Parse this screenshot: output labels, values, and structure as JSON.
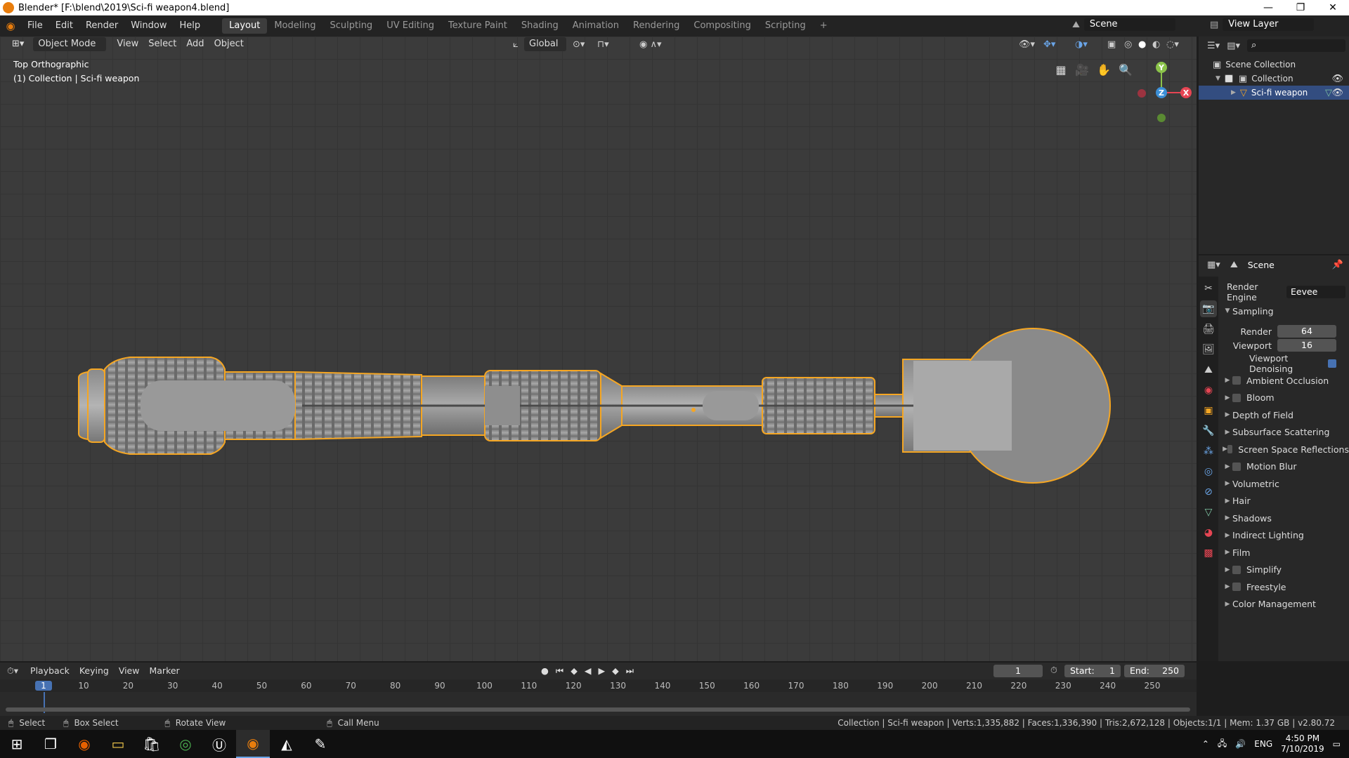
{
  "window": {
    "title": "Blender* [F:\\blend\\2019\\Sci-fi weapon4.blend]",
    "minimize": "—",
    "maximize": "❐",
    "close": "✕"
  },
  "menubar": {
    "items": [
      "File",
      "Edit",
      "Render",
      "Window",
      "Help"
    ]
  },
  "workspaces": {
    "tabs": [
      "Layout",
      "Modeling",
      "Sculpting",
      "UV Editing",
      "Texture Paint",
      "Shading",
      "Animation",
      "Rendering",
      "Compositing",
      "Scripting"
    ],
    "active": "Layout",
    "add": "+"
  },
  "scene": {
    "scene_name": "Scene",
    "view_layer": "View Layer"
  },
  "viewport": {
    "mode": "Object Mode",
    "menus": [
      "View",
      "Select",
      "Add",
      "Object"
    ],
    "orientation": "Global",
    "view_name": "Top Orthographic",
    "collection_info": "(1) Collection | Sci-fi weapon",
    "gizmo": {
      "y": "Y",
      "z": "Z",
      "x": "X"
    }
  },
  "outliner": {
    "search_placeholder": "",
    "items": [
      {
        "label": "Scene Collection"
      },
      {
        "label": "Collection"
      },
      {
        "label": "Sci-fi weapon"
      }
    ]
  },
  "properties": {
    "context": "Scene",
    "render_engine_label": "Render Engine",
    "render_engine": "Eevee",
    "sampling": {
      "label": "Sampling",
      "render_label": "Render",
      "render": "64",
      "viewport_label": "Viewport",
      "viewport": "16",
      "denoise_label": "Viewport Denoising"
    },
    "panels": [
      {
        "label": "Ambient Occlusion",
        "checkbox": true
      },
      {
        "label": "Bloom",
        "checkbox": true
      },
      {
        "label": "Depth of Field",
        "checkbox": false
      },
      {
        "label": "Subsurface Scattering",
        "checkbox": false
      },
      {
        "label": "Screen Space Reflections",
        "checkbox": true
      },
      {
        "label": "Motion Blur",
        "checkbox": true
      },
      {
        "label": "Volumetric",
        "checkbox": false
      },
      {
        "label": "Hair",
        "checkbox": false
      },
      {
        "label": "Shadows",
        "checkbox": false
      },
      {
        "label": "Indirect Lighting",
        "checkbox": false
      },
      {
        "label": "Film",
        "checkbox": false
      },
      {
        "label": "Simplify",
        "checkbox": true
      },
      {
        "label": "Freestyle",
        "checkbox": true
      },
      {
        "label": "Color Management",
        "checkbox": false
      }
    ]
  },
  "timeline": {
    "menus": [
      "Playback",
      "Keying",
      "View",
      "Marker"
    ],
    "current_frame": "1",
    "start_label": "Start:",
    "start": "1",
    "end_label": "End:",
    "end": "250",
    "ticks": [
      "1",
      "10",
      "20",
      "30",
      "40",
      "50",
      "60",
      "70",
      "80",
      "90",
      "100",
      "110",
      "120",
      "130",
      "140",
      "150",
      "160",
      "170",
      "180",
      "190",
      "200",
      "210",
      "220",
      "230",
      "240",
      "250"
    ]
  },
  "statusbar": {
    "select": "Select",
    "box_select": "Box Select",
    "rotate": "Rotate View",
    "call_menu": "Call Menu",
    "info": "Collection | Sci-fi weapon | Verts:1,335,882 | Faces:1,336,390 | Tris:2,672,128 | Objects:1/1 | Mem: 1.37 GB | v2.80.72"
  },
  "taskbar": {
    "lang": "ENG",
    "time": "4:50 PM",
    "date": "7/10/2019"
  },
  "colors": {
    "accent": "#4772b3",
    "selection_outline": "#f5a623",
    "x_axis": "#e64553",
    "y_axis": "#8bc34a",
    "z_axis": "#3c8fd6"
  }
}
